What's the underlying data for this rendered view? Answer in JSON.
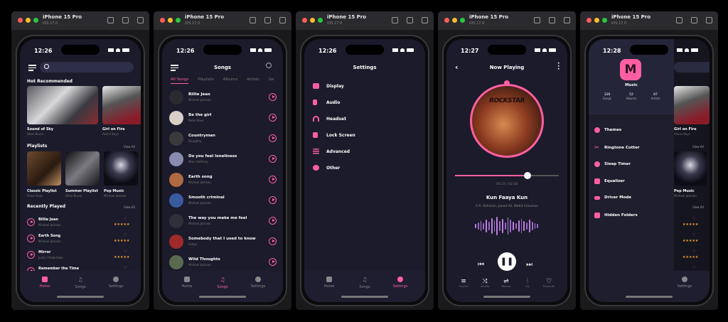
{
  "colors": {
    "accent": "#ff5fa2",
    "bg": "#1b1b2b",
    "card": "#22223a"
  },
  "device": {
    "name": "iPhone 15 Pro",
    "os": "iOS 17.0"
  },
  "home": {
    "time": "12:26",
    "hot_title": "Hot Recommended",
    "hot": [
      {
        "title": "Sound of Sky",
        "sub": "Dilon Bruce"
      },
      {
        "title": "Girl on Fire",
        "sub": "Alecia Keys"
      }
    ],
    "playlists_title": "Playlists",
    "view_all": "View All",
    "playlists": [
      {
        "title": "Classic Playlist",
        "sub": "Piano Guys"
      },
      {
        "title": "Summer Playlist",
        "sub": "Dilon Bruce"
      },
      {
        "title": "Pop Music",
        "sub": "Michael Jackson"
      }
    ],
    "recent_title": "Recently Played",
    "recent": [
      {
        "title": "Billie Jean",
        "sub": "Michael Jackson"
      },
      {
        "title": "Earth Song",
        "sub": "Michael Jackson"
      },
      {
        "title": "Mirror",
        "sub": "Justin Timberlake"
      },
      {
        "title": "Remember the Time",
        "sub": "Michael Jackson"
      }
    ],
    "stars": "★★★★★"
  },
  "tabs": {
    "home": "Home",
    "songs": "Songs",
    "settings": "Settings"
  },
  "songs": {
    "time": "12:26",
    "title": "Songs",
    "filters": [
      "All Songs",
      "Playlists",
      "Albums",
      "Artists",
      "Ge"
    ],
    "list": [
      {
        "title": "Billie Jean",
        "sub": "Michael Jackson"
      },
      {
        "title": "Be the girl",
        "sub": "Bebe Rexa"
      },
      {
        "title": "Countryman",
        "sub": "Daughtry"
      },
      {
        "title": "Do you feel loneliness",
        "sub": "Marc Anthony"
      },
      {
        "title": "Earth song",
        "sub": "Michael Jackson"
      },
      {
        "title": "Smooth criminal",
        "sub": "Michael Jackson"
      },
      {
        "title": "The way you make me feel",
        "sub": "Michael Jackson"
      },
      {
        "title": "Somebody that I used to know",
        "sub": "Gotye"
      },
      {
        "title": "Wild Thoughts",
        "sub": "Michael Jackson"
      }
    ]
  },
  "settings": {
    "time": "12:26",
    "title": "Settings",
    "items": [
      "Display",
      "Audio",
      "Headset",
      "Lock Screen",
      "Advanced",
      "Other"
    ]
  },
  "now": {
    "time": "12:27",
    "title": "Now Playing",
    "album_text": "ROCKSTAR",
    "elapsed": "00:33",
    "duration": "02:18",
    "progress": 0.7,
    "song": "Kun Faaya Kun",
    "artists": "A.R. Rahman, Javed Ali, Mohit Chauhan",
    "controls": [
      "Playlist",
      "Shuffle",
      "Repeat",
      "EQ",
      "Favourite"
    ]
  },
  "drawer": {
    "time": "12:28",
    "app": "Muzic",
    "stats": [
      {
        "n": "328",
        "l": "Songs"
      },
      {
        "n": "52",
        "l": "Albums"
      },
      {
        "n": "87",
        "l": "Artists"
      }
    ],
    "items": [
      "Themes",
      "Ringtone Cutter",
      "Sleep Timer",
      "Equalizer",
      "Driver Mode",
      "Hidden Folders"
    ],
    "peek": {
      "hot": "Girl on Fire",
      "hot_sub": "Alecia Keys",
      "view_all": "View All",
      "pop": "Pop Music",
      "pop_sub": "Michael Jackson",
      "settings": "Settings"
    }
  }
}
